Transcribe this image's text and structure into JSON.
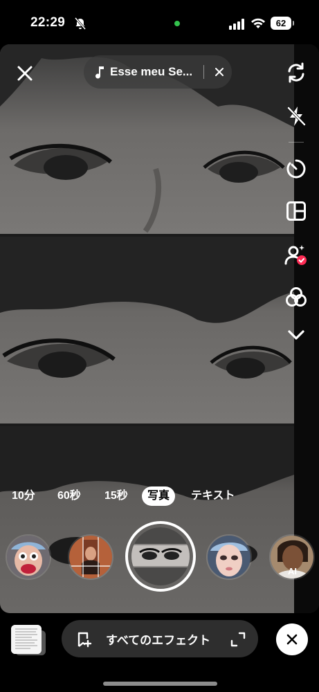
{
  "status_bar": {
    "time": "22:29",
    "battery": "62"
  },
  "music": {
    "title": "Esse meu Se..."
  },
  "modes": [
    {
      "label": "10分",
      "active": false
    },
    {
      "label": "60秒",
      "active": false
    },
    {
      "label": "15秒",
      "active": false
    },
    {
      "label": "写真",
      "active": true
    },
    {
      "label": "テキスト",
      "active": false
    }
  ],
  "effects": [
    {
      "name": "effect-clown-face"
    },
    {
      "name": "effect-photo-grid"
    },
    {
      "name": "effect-selected-eyes"
    },
    {
      "name": "effect-doll-face"
    },
    {
      "name": "effect-ai-portrait",
      "badge": "AI"
    }
  ],
  "bottom_bar": {
    "effects_label": "すべてのエフェクト"
  },
  "side_tools": [
    "flip-camera-icon",
    "flash-off-icon",
    "timer-icon",
    "layout-icon",
    "face-retouch-icon",
    "filters-icon",
    "chevron-down-icon"
  ],
  "colors": {
    "accent_red": "#fe2c55",
    "status_green": "#33c24d",
    "pill_bg": "#2e2e2e"
  }
}
